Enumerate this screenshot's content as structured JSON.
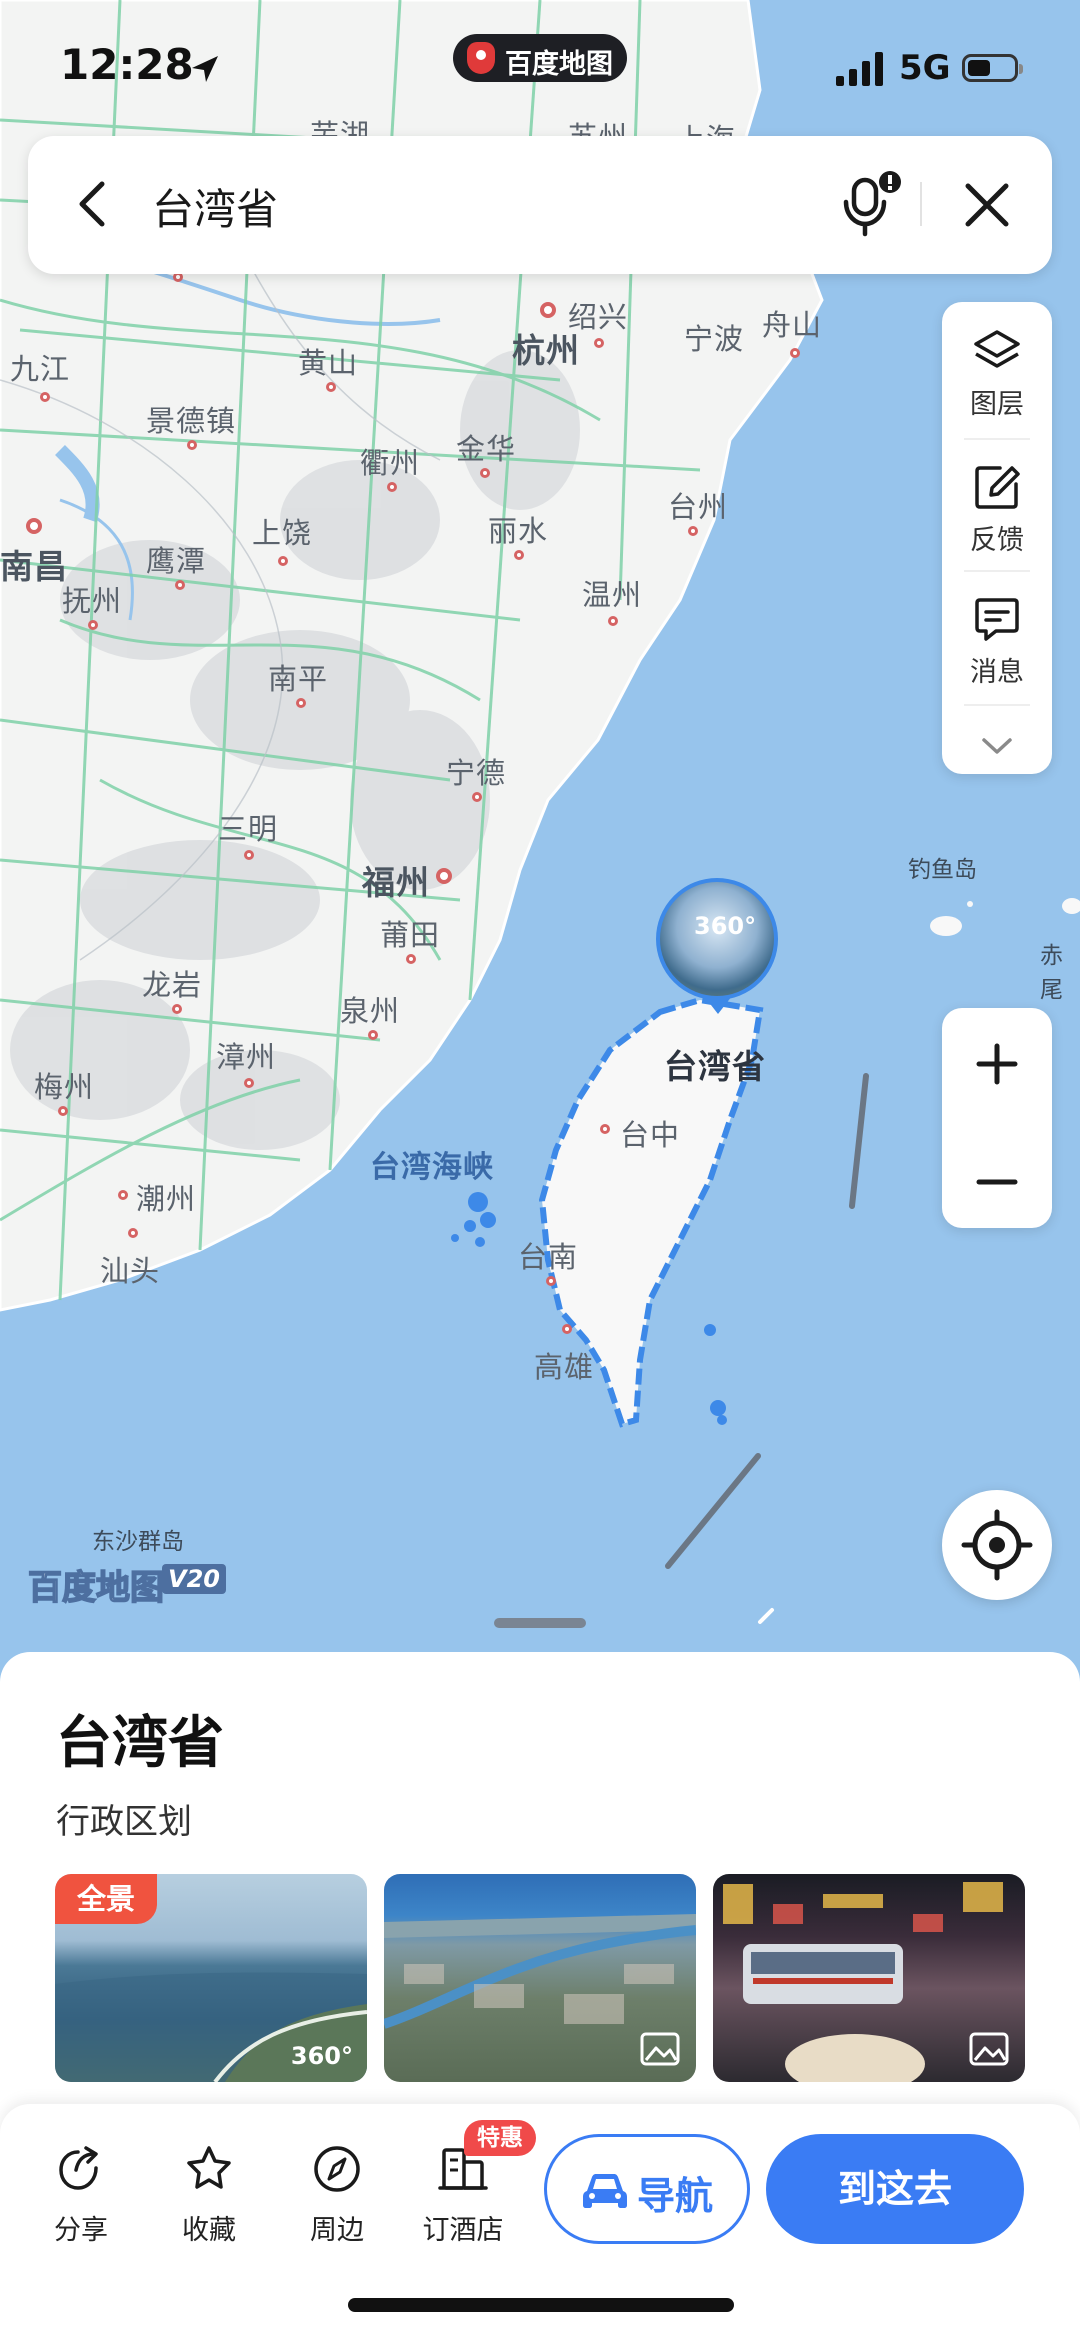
{
  "status": {
    "time": "12:28",
    "network": "5G",
    "brand": "百度地图"
  },
  "search": {
    "query": "台湾省"
  },
  "tools": {
    "layers": "图层",
    "feedback": "反馈",
    "messages": "消息"
  },
  "map": {
    "cities": [
      {
        "name": "芜湖"
      },
      {
        "name": "苏州"
      },
      {
        "name": "上海"
      },
      {
        "name": "绍兴"
      },
      {
        "name": "杭州"
      },
      {
        "name": "宁波"
      },
      {
        "name": "舟山"
      },
      {
        "name": "九江"
      },
      {
        "name": "黄山"
      },
      {
        "name": "景德镇"
      },
      {
        "name": "衢州"
      },
      {
        "name": "金华"
      },
      {
        "name": "台州"
      },
      {
        "name": "南昌"
      },
      {
        "name": "上饶"
      },
      {
        "name": "丽水"
      },
      {
        "name": "鹰潭"
      },
      {
        "name": "抚州"
      },
      {
        "name": "温州"
      },
      {
        "name": "南平"
      },
      {
        "name": "宁德"
      },
      {
        "name": "三明"
      },
      {
        "name": "福州"
      },
      {
        "name": "莆田"
      },
      {
        "name": "龙岩"
      },
      {
        "name": "泉州"
      },
      {
        "name": "漳州"
      },
      {
        "name": "梅州"
      },
      {
        "name": "潮州"
      },
      {
        "name": "汕头"
      },
      {
        "name": "台中"
      },
      {
        "name": "台南"
      },
      {
        "name": "高雄"
      }
    ],
    "province_label": "台湾省",
    "strait_label": "台湾海峡",
    "islands": {
      "diaoyu": "钓鱼岛",
      "chiwei": "赤尾",
      "dongsha": "东沙群岛"
    },
    "pano_label": "360°",
    "watermark": "百度地图",
    "watermark_version": "V20"
  },
  "place": {
    "title": "台湾省",
    "type": "行政区划",
    "photos": [
      {
        "badge": "全景",
        "mark": "360°"
      },
      {
        "kind": "image"
      },
      {
        "kind": "image"
      }
    ]
  },
  "actions": {
    "share": "分享",
    "favorite": "收藏",
    "nearby": "周边",
    "hotel": "订酒店",
    "hotel_badge": "特惠",
    "navigate": "导航",
    "go": "到这去"
  },
  "colors": {
    "accent": "#3a7cf4",
    "sea": "#97c4ec",
    "land": "#f3f4f3",
    "badge": "#f0533f"
  }
}
